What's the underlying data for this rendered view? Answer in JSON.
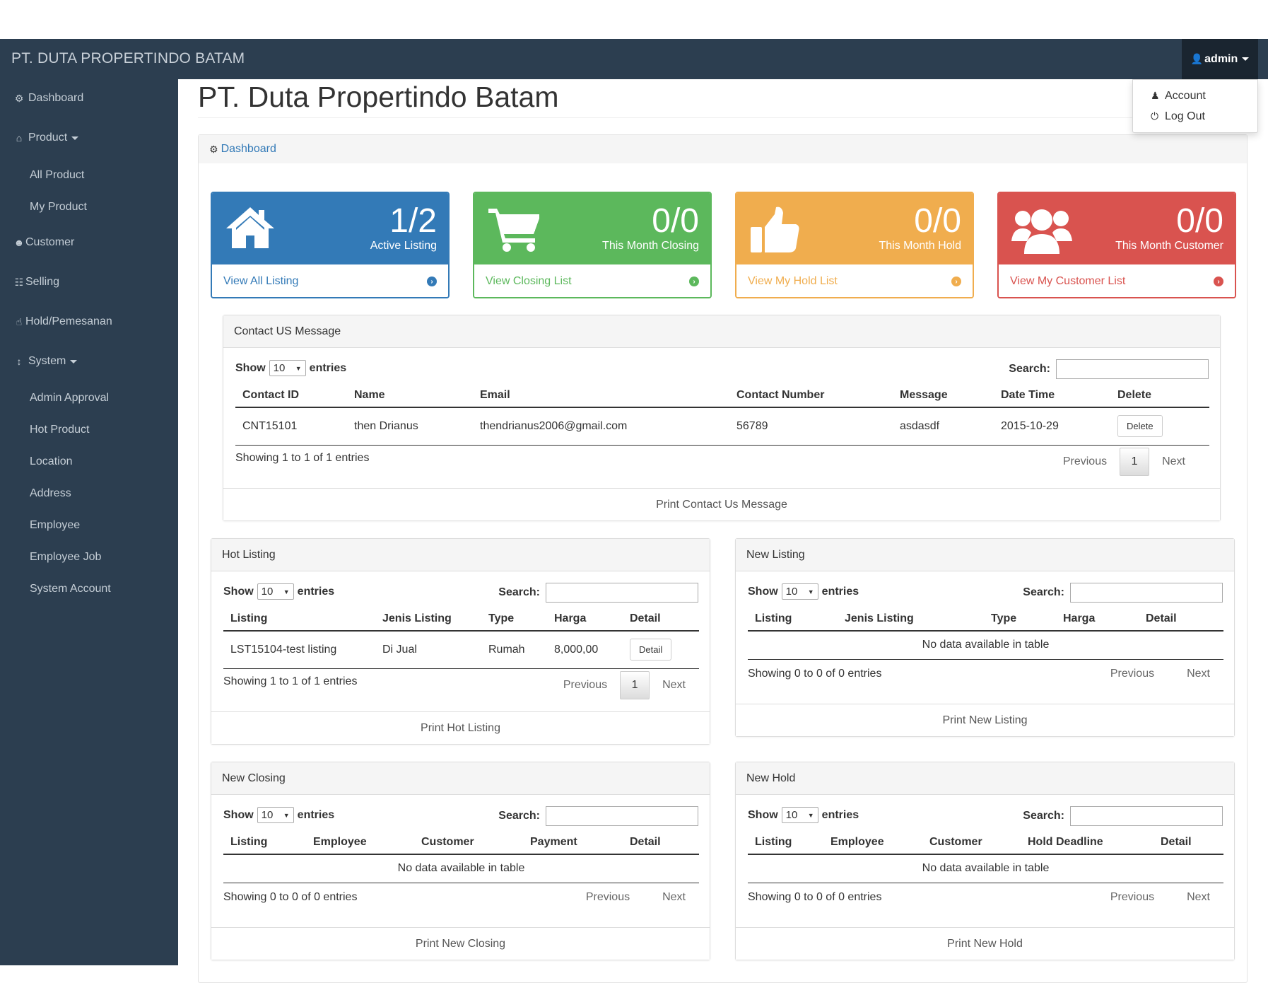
{
  "app": {
    "brand": "PT. DUTA PROPERTINDO BATAM",
    "user": "admin"
  },
  "user_menu": {
    "items": [
      {
        "label": "Account"
      },
      {
        "label": "Log Out"
      }
    ]
  },
  "sidebar": {
    "dashboard": "Dashboard",
    "product": "Product",
    "product_sub": [
      "All Product",
      "My Product"
    ],
    "customer": "Customer",
    "selling": "Selling",
    "hold": "Hold/Pemesanan",
    "system": "System",
    "system_sub": [
      "Admin Approval",
      "Hot Product",
      "Location",
      "Address",
      "Employee",
      "Employee Job",
      "System Account"
    ]
  },
  "page": {
    "title": "PT. Duta Propertindo Batam",
    "breadcrumb": "Dashboard"
  },
  "cards": [
    {
      "value": "1/2",
      "label": "Active Listing",
      "link": "View All Listing",
      "color": "#337ab7"
    },
    {
      "value": "0/0",
      "label": "This Month Closing",
      "link": "View Closing List",
      "color": "#5cb85c"
    },
    {
      "value": "0/0",
      "label": "This Month Hold",
      "link": "View My Hold List",
      "color": "#f0ad4e"
    },
    {
      "value": "0/0",
      "label": "This Month Customer",
      "link": "View My Customer List",
      "color": "#d9534f"
    }
  ],
  "common": {
    "show": "Show",
    "entries": "entries",
    "page_size": "10",
    "search": "Search:",
    "previous": "Previous",
    "next": "Next",
    "page": "1",
    "no_data": "No data available in table"
  },
  "contact": {
    "title": "Contact US Message",
    "columns": [
      "Contact ID",
      "Name",
      "Email",
      "Contact Number",
      "Message",
      "Date Time",
      "Delete"
    ],
    "rows": [
      {
        "id": "CNT15101",
        "name": "then Drianus",
        "email": "thendrianus2006@gmail.com",
        "number": "56789",
        "message": "asdasdf",
        "date": "2015-10-29",
        "action": "Delete"
      }
    ],
    "info": "Showing 1 to 1 of 1 entries",
    "print": "Print Contact Us Message"
  },
  "hot_listing": {
    "title": "Hot Listing",
    "columns": [
      "Listing",
      "Jenis Listing",
      "Type",
      "Harga",
      "Detail"
    ],
    "rows": [
      {
        "listing": "LST15104-test listing",
        "jenis": "Di Jual",
        "type": "Rumah",
        "harga": "8,000,00",
        "action": "Detail"
      }
    ],
    "info": "Showing 1 to 1 of 1 entries",
    "print": "Print Hot Listing"
  },
  "new_listing": {
    "title": "New Listing",
    "columns": [
      "Listing",
      "Jenis Listing",
      "Type",
      "Harga",
      "Detail"
    ],
    "info": "Showing 0 to 0 of 0 entries",
    "print": "Print New Listing"
  },
  "new_closing": {
    "title": "New Closing",
    "columns": [
      "Listing",
      "Employee",
      "Customer",
      "Payment",
      "Detail"
    ],
    "info": "Showing 0 to 0 of 0 entries",
    "print": "Print New Closing"
  },
  "new_hold": {
    "title": "New Hold",
    "columns": [
      "Listing",
      "Employee",
      "Customer",
      "Hold Deadline",
      "Detail"
    ],
    "info": "Showing 0 to 0 of 0 entries",
    "print": "Print New Hold"
  }
}
